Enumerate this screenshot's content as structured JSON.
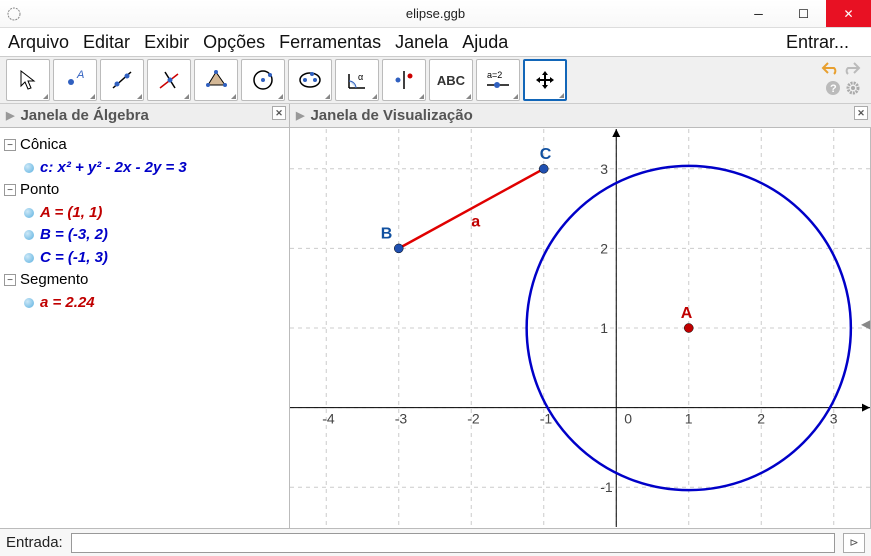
{
  "window": {
    "title": "elipse.ggb"
  },
  "menu": {
    "arquivo": "Arquivo",
    "editar": "Editar",
    "exibir": "Exibir",
    "opcoes": "Opções",
    "ferramentas": "Ferramentas",
    "janela": "Janela",
    "ajuda": "Ajuda",
    "entrar": "Entrar..."
  },
  "panels": {
    "algebra_title": "Janela de Álgebra",
    "graphics_title": "Janela de Visualização"
  },
  "tree": {
    "conic_label": "Cônica",
    "conic_c": "c: x² + y² - 2x - 2y = 3",
    "point_label": "Ponto",
    "point_a": "A = (1, 1)",
    "point_b": "B = (-3, 2)",
    "point_c": "C = (-1, 3)",
    "segment_label": "Segmento",
    "segment_a": "a = 2.24"
  },
  "input": {
    "label": "Entrada:",
    "value": ""
  },
  "toolbar": {
    "slider_text": "a=2"
  },
  "chart_data": {
    "type": "scatter",
    "title": "",
    "xlabel": "",
    "ylabel": "",
    "xlim": [
      -4.5,
      3.5
    ],
    "ylim": [
      -1.5,
      3.5
    ],
    "xticks": [
      -4,
      -3,
      -2,
      -1,
      0,
      1,
      2,
      3
    ],
    "yticks": [
      -1,
      0,
      1,
      2,
      3
    ],
    "grid": true,
    "circle": {
      "center": [
        1,
        1
      ],
      "radius": 2.236,
      "label": "c"
    },
    "segment": {
      "from": [
        -3,
        2
      ],
      "to": [
        -1,
        3
      ],
      "label": "a"
    },
    "points": [
      {
        "name": "A",
        "coords": [
          1,
          1
        ],
        "color": "#c00000"
      },
      {
        "name": "B",
        "coords": [
          -3,
          2
        ],
        "color": "#1050a0"
      },
      {
        "name": "C",
        "coords": [
          -1,
          3
        ],
        "color": "#1050a0"
      }
    ]
  }
}
